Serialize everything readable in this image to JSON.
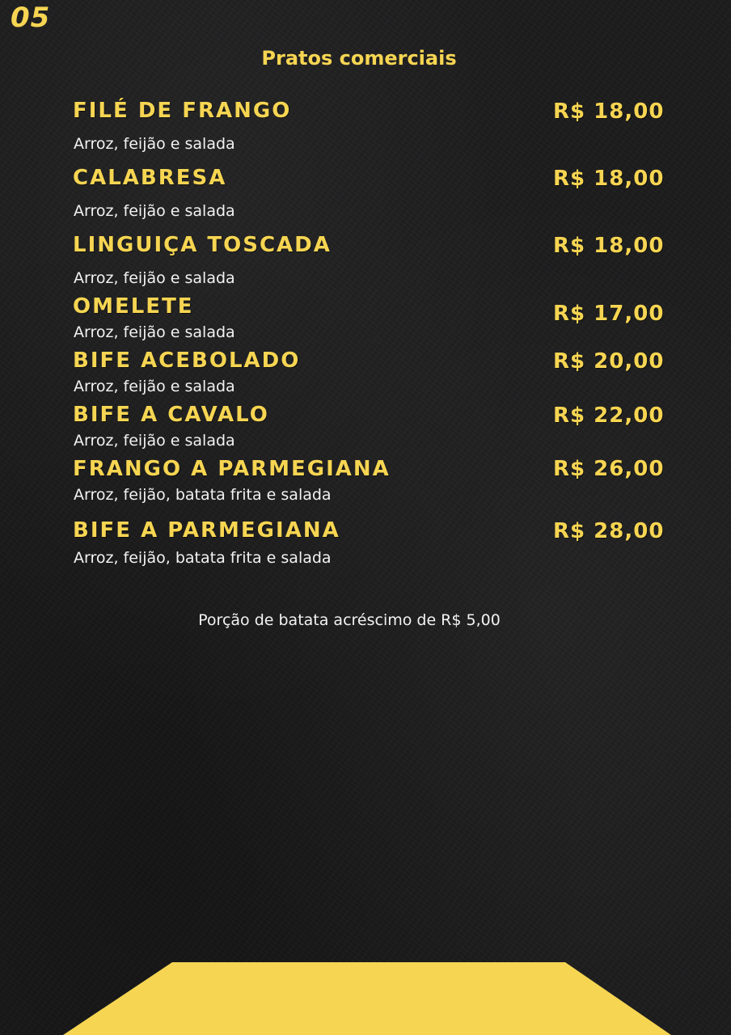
{
  "page_number": "05",
  "section_title": "Pratos comerciais",
  "items": [
    {
      "name": "FILÉ DE FRANGO",
      "price": "R$ 18,00",
      "description": "Arroz, feijão e salada"
    },
    {
      "name": "CALABRESA",
      "price": "R$ 18,00",
      "description": "Arroz, feijão e salada"
    },
    {
      "name": "LINGUIÇA TOSCADA",
      "price": "R$ 18,00",
      "description": "Arroz, feijão e salada"
    },
    {
      "name": "OMELETE",
      "price": "R$ 17,00",
      "description": "Arroz, feijão e salada"
    },
    {
      "name": "BIFE ACEBOLADO",
      "price": "R$ 20,00",
      "description": "Arroz, feijão e salada"
    },
    {
      "name": "BIFE A CAVALO",
      "price": "R$ 22,00",
      "description": "Arroz, feijão e salada"
    },
    {
      "name": "FRANGO A PARMEGIANA",
      "price": "R$ 26,00",
      "description": "Arroz, feijão, batata frita e salada"
    },
    {
      "name": "BIFE A PARMEGIANA",
      "price": "R$ 28,00",
      "description": "Arroz, feijão, batata frita e salada"
    }
  ],
  "footnote": "Porção de batata acréscimo de R$ 5,00",
  "colors": {
    "accent": "#f6d552",
    "background": "#1c1c1d",
    "text": "#f2f2f2"
  }
}
